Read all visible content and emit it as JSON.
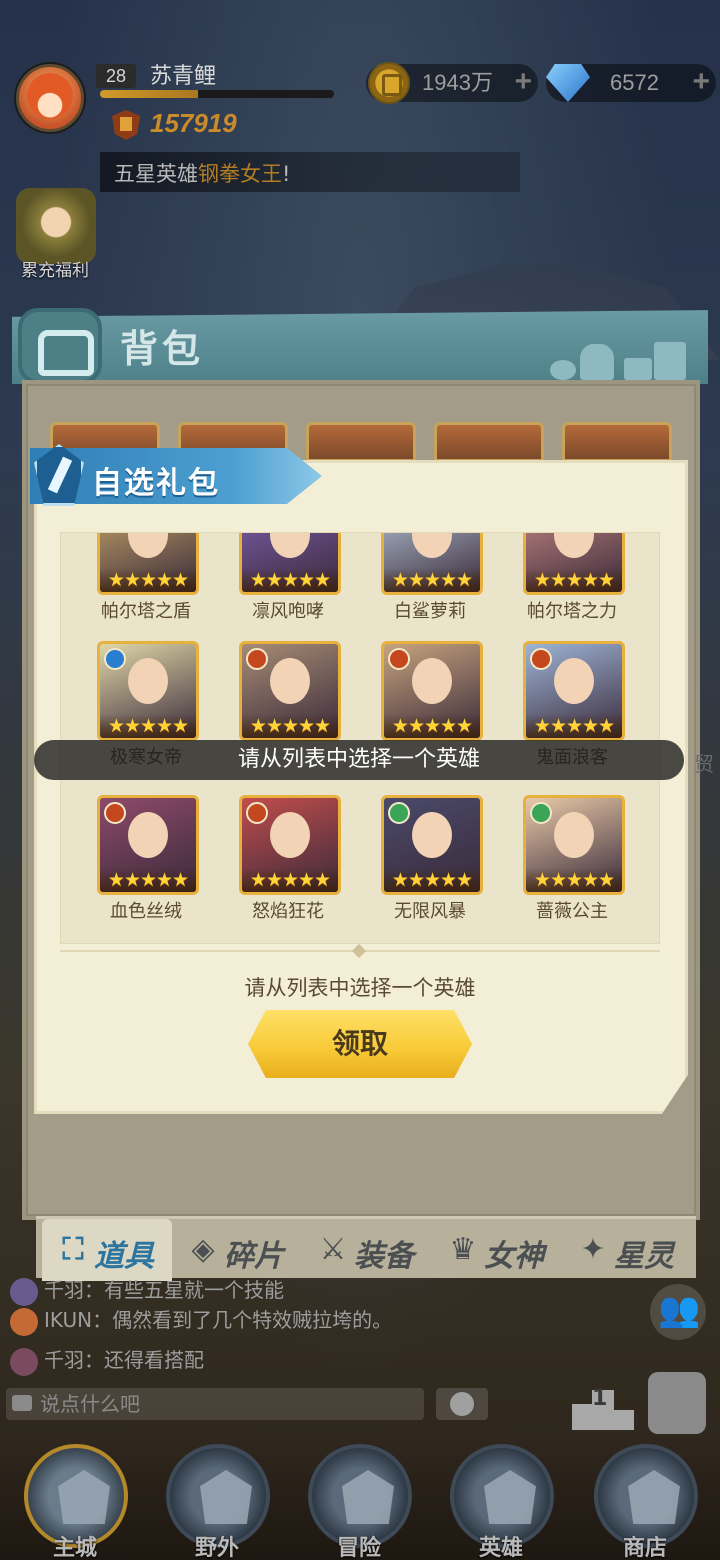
{
  "player": {
    "level": "28",
    "name": "苏青鲤",
    "power": "157919",
    "exp_fraction": 0.42
  },
  "resources": {
    "gold": "1943万",
    "gems": "6572",
    "plus": "+"
  },
  "marquee": {
    "prefix": "五星英雄",
    "highlight": "钢拳女王",
    "suffix": "!"
  },
  "recharge": {
    "label": "累充福利"
  },
  "backpack": {
    "title": "背包",
    "tabs": [
      {
        "label": "道具",
        "icon": "props-icon"
      },
      {
        "label": "碎片",
        "icon": "shard-icon"
      },
      {
        "label": "装备",
        "icon": "equipment-icon"
      },
      {
        "label": "女神",
        "icon": "goddess-icon"
      },
      {
        "label": "星灵",
        "icon": "star-spirit-icon"
      }
    ]
  },
  "dialog": {
    "title": "自选礼包",
    "hint": "请从列表中选择一个英雄",
    "claim_label": "领取",
    "heroes": [
      {
        "name": "帕尔塔之盾",
        "element": "",
        "stars": "★★★★★"
      },
      {
        "name": "凛风咆哮",
        "element": "",
        "stars": "★★★★★"
      },
      {
        "name": "白鲨萝莉",
        "element": "",
        "stars": "★★★★★"
      },
      {
        "name": "帕尔塔之力",
        "element": "",
        "stars": "★★★★★"
      },
      {
        "name": "极寒女帝",
        "element": "ice",
        "stars": "★★★★★"
      },
      {
        "name": "",
        "element": "fire",
        "stars": "★★★★★"
      },
      {
        "name": "",
        "element": "fire",
        "stars": "★★★★★"
      },
      {
        "name": "鬼面浪客",
        "element": "fire",
        "stars": "★★★★★"
      },
      {
        "name": "血色丝绒",
        "element": "fire",
        "stars": "★★★★★"
      },
      {
        "name": "怒焰狂花",
        "element": "fire",
        "stars": "★★★★★"
      },
      {
        "name": "无限风暴",
        "element": "wind",
        "stars": "★★★★★"
      },
      {
        "name": "蔷薇公主",
        "element": "wind",
        "stars": "★★★★★"
      }
    ]
  },
  "toast": {
    "text": "请从列表中选择一个英雄",
    "tail": "贸"
  },
  "chat": {
    "lines": [
      {
        "text": "千羽：有些五星就一个技能"
      },
      {
        "text": "IKUN：偶然看到了几个特效贼拉垮的。"
      },
      {
        "text": "千羽：还得看搭配"
      }
    ],
    "placeholder": "说点什么吧",
    "rank_number": "1"
  },
  "nav": [
    {
      "label": "主城"
    },
    {
      "label": "野外"
    },
    {
      "label": "冒险"
    },
    {
      "label": "英雄"
    },
    {
      "label": "商店"
    }
  ]
}
